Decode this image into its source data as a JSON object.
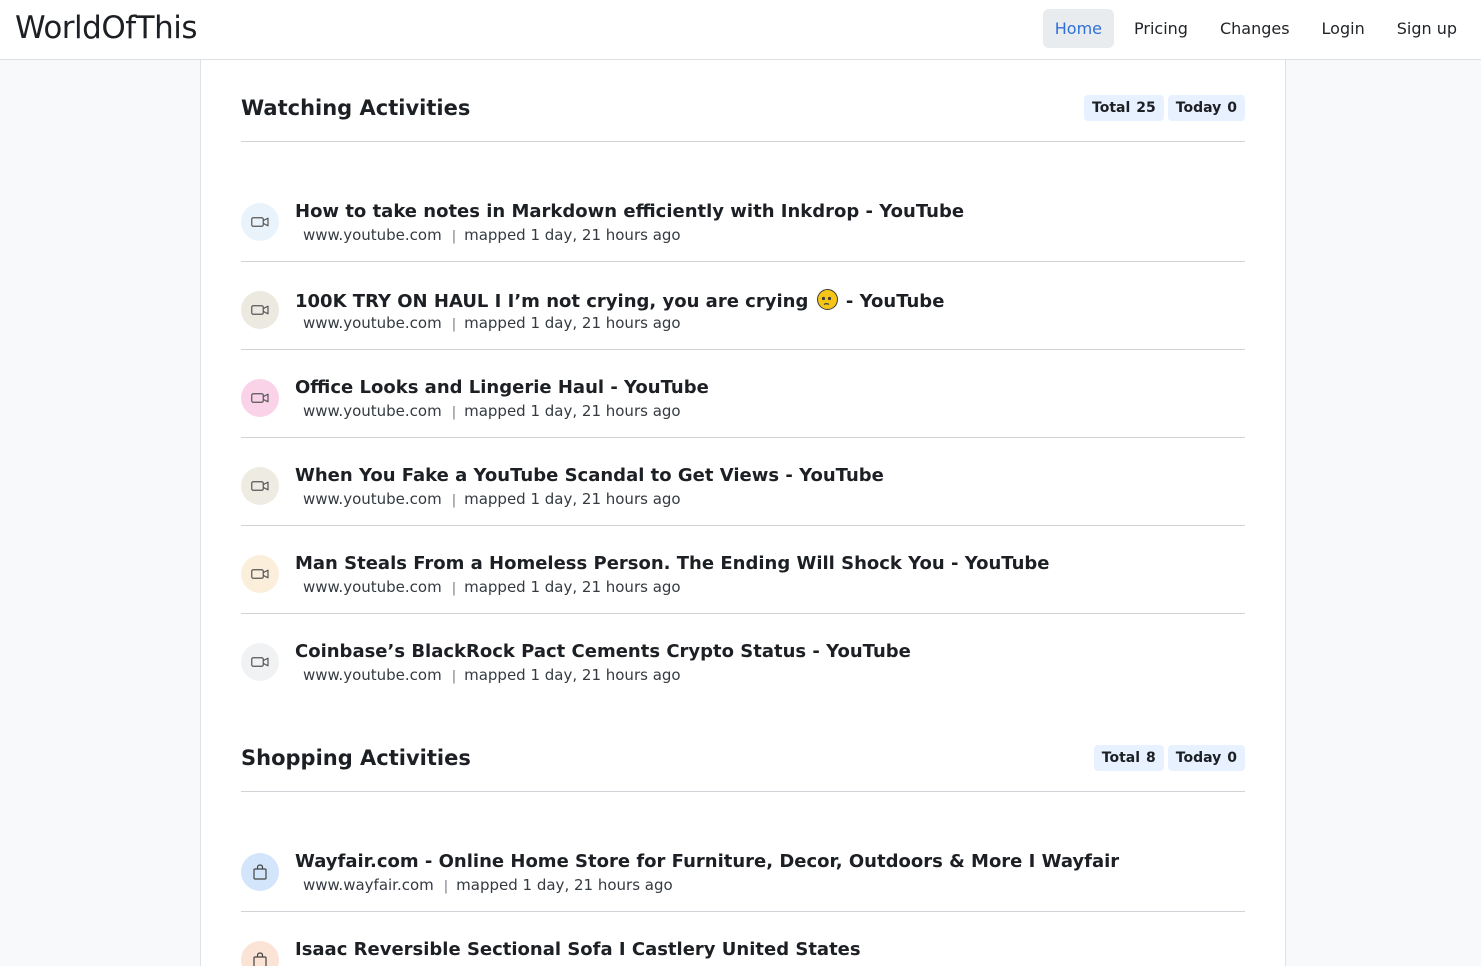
{
  "brand": "WorldOfThis",
  "nav": [
    "Home",
    "Pricing",
    "Changes",
    "Login",
    "Sign up"
  ],
  "nav_active": "Home",
  "watching": {
    "title": "Watching Activities",
    "total_label": "Total",
    "total": "25",
    "today_label": "Today",
    "today": "0",
    "items": [
      {
        "title": "How to take notes in Markdown efficiently with Inkdrop - YouTube",
        "domain": "www.youtube.com",
        "time": "mapped 1 day, 21 hours ago",
        "icon": "video-camera-icon",
        "color": "#e9f3fb"
      },
      {
        "title_before": "100K TRY ON HAUL I I’m not crying, you are crying",
        "title_after": "- YouTube",
        "domain": "www.youtube.com",
        "time": "mapped 1 day, 21 hours ago",
        "icon": "video-camera-icon",
        "color": "#ece9e1"
      },
      {
        "title": "Office Looks and Lingerie Haul - YouTube",
        "domain": "www.youtube.com",
        "time": "mapped 1 day, 21 hours ago",
        "icon": "video-camera-icon",
        "color": "#fbd3e9"
      },
      {
        "title": "When You Fake a YouTube Scandal to Get Views - YouTube",
        "domain": "www.youtube.com",
        "time": "mapped 1 day, 21 hours ago",
        "icon": "video-camera-icon",
        "color": "#eeebe2"
      },
      {
        "title": "Man Steals From a Homeless Person. The Ending Will Shock You - YouTube",
        "domain": "www.youtube.com",
        "time": "mapped 1 day, 21 hours ago",
        "icon": "video-camera-icon",
        "color": "#fbefdc"
      },
      {
        "title": "Coinbase’s BlackRock Pact Cements Crypto Status - YouTube",
        "domain": "www.youtube.com",
        "time": "mapped 1 day, 21 hours ago",
        "icon": "video-camera-icon",
        "color": "#f1f2f3"
      }
    ]
  },
  "shopping": {
    "title": "Shopping Activities",
    "total_label": "Total",
    "total": "8",
    "today_label": "Today",
    "today": "0",
    "items": [
      {
        "title": "Wayfair.com - Online Home Store for Furniture, Decor, Outdoors & More I Wayfair",
        "domain": "www.wayfair.com",
        "time": "mapped 1 day, 21 hours ago",
        "icon": "shopping-bag-icon",
        "color": "#d3e5fb"
      },
      {
        "title": "Isaac Reversible Sectional Sofa I Castlery United States",
        "icon": "shopping-bag-icon",
        "color": "#fbe3d6"
      }
    ]
  }
}
